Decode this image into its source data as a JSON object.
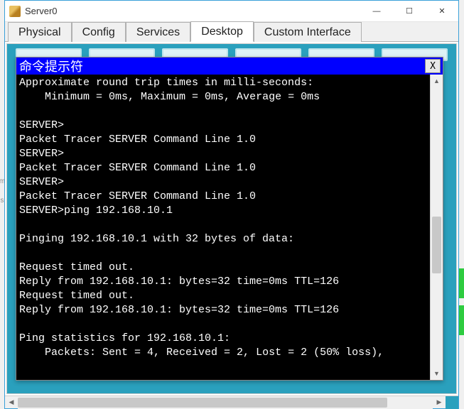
{
  "window": {
    "title": "Server0",
    "min": "—",
    "max": "☐",
    "close": "✕"
  },
  "tabs": [
    {
      "label": "Physical",
      "active": false
    },
    {
      "label": "Config",
      "active": false
    },
    {
      "label": "Services",
      "active": false
    },
    {
      "label": "Desktop",
      "active": true
    },
    {
      "label": "Custom Interface",
      "active": false
    }
  ],
  "cmd": {
    "title": "命令提示符",
    "close": "X",
    "lines": [
      "Approximate round trip times in milli-seconds:",
      "    Minimum = 0ms, Maximum = 0ms, Average = 0ms",
      "",
      "SERVER>",
      "Packet Tracer SERVER Command Line 1.0",
      "SERVER>",
      "Packet Tracer SERVER Command Line 1.0",
      "SERVER>",
      "Packet Tracer SERVER Command Line 1.0",
      "SERVER>ping 192.168.10.1",
      "",
      "Pinging 192.168.10.1 with 32 bytes of data:",
      "",
      "Request timed out.",
      "Reply from 192.168.10.1: bytes=32 time=0ms TTL=126",
      "Request timed out.",
      "Reply from 192.168.10.1: bytes=32 time=0ms TTL=126",
      "",
      "Ping statistics for 192.168.10.1:",
      "    Packets: Sent = 4, Received = 2, Lost = 2 (50% loss),"
    ]
  },
  "scroll": {
    "up": "▲",
    "down": "▼",
    "left": "◀",
    "right": "▶"
  }
}
